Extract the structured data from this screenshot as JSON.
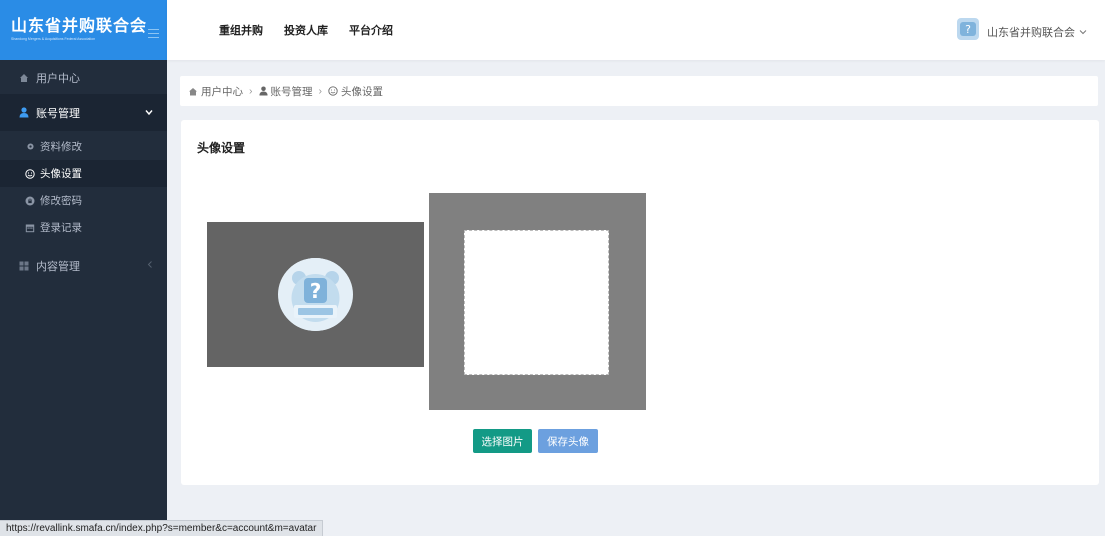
{
  "brand": {
    "title": "山东省并购联合会",
    "subtitle": "Shandong Mergers & Acquisitions Federal Association",
    "accent": "#2a8ce6"
  },
  "topnav": [
    "重组并购",
    "投资人库",
    "平台介绍"
  ],
  "user": {
    "name": "山东省并购联合会"
  },
  "sidebar": {
    "items": [
      {
        "label": "用户中心",
        "icon": "home-icon"
      },
      {
        "label": "账号管理",
        "icon": "user-icon"
      },
      {
        "label": "内容管理",
        "icon": "grid-icon"
      }
    ],
    "sub_items": [
      {
        "label": "资料修改",
        "icon": "gear-icon"
      },
      {
        "label": "头像设置",
        "icon": "smile-icon"
      },
      {
        "label": "修改密码",
        "icon": "lock-icon"
      },
      {
        "label": "登录记录",
        "icon": "calendar-icon"
      }
    ]
  },
  "breadcrumb": [
    "用户中心",
    "账号管理",
    "头像设置"
  ],
  "panel": {
    "title": "头像设置",
    "select_button": "选择图片",
    "save_button": "保存头像"
  },
  "status_url": "https://revallink.smafa.cn/index.php?s=member&c=account&m=avatar"
}
